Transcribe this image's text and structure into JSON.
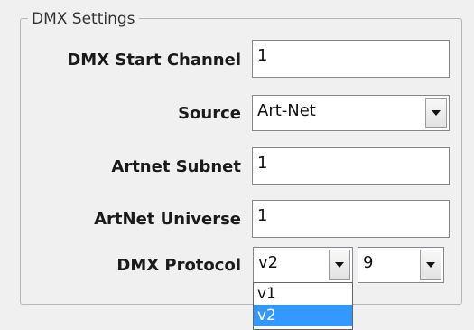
{
  "group": {
    "title": "DMX Settings"
  },
  "fields": {
    "start_channel": {
      "label": "DMX Start Channel",
      "value": "1"
    },
    "source": {
      "label": "Source",
      "value": "Art-Net"
    },
    "artnet_subnet": {
      "label": "Artnet Subnet",
      "value": "1"
    },
    "artnet_universe": {
      "label": "ArtNet Universe",
      "value": "1"
    },
    "dmx_protocol": {
      "label": "DMX Protocol",
      "version_value": "v2",
      "rate_value": "9"
    }
  },
  "protocol_dropdown": {
    "options": [
      "v1",
      "v2"
    ],
    "selected": "v2"
  },
  "colors": {
    "selection": "#3399ff",
    "panel_bg": "#f0f0f0"
  }
}
